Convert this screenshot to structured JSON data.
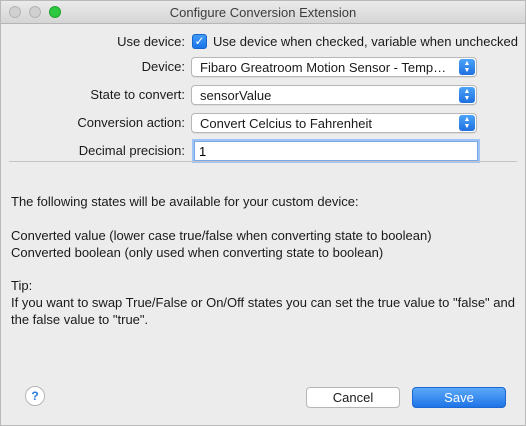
{
  "window": {
    "title": "Configure Conversion Extension"
  },
  "form": {
    "use_device": {
      "label": "Use device:",
      "checked": true,
      "checkbox_label": "Use device when checked, variable when unchecked"
    },
    "device": {
      "label": "Device:",
      "value": "Fibaro Greatroom Motion Sensor - Temperature"
    },
    "state_to_convert": {
      "label": "State to convert:",
      "value": "sensorValue"
    },
    "conversion_action": {
      "label": "Conversion action:",
      "value": "Convert Celcius to Fahrenheit"
    },
    "decimal_precision": {
      "label": "Decimal precision:",
      "value": "1"
    }
  },
  "info": {
    "intro": "The following states will be available for your custom device:",
    "states": [
      "Converted value (lower case true/false when converting state to boolean)",
      "Converted boolean (only used when converting state to boolean)"
    ],
    "tip_heading": "Tip:",
    "tip_body": "If you want to swap True/False or On/Off states you can set the true value to \"false\" and the false value to \"true\"."
  },
  "buttons": {
    "help": "?",
    "cancel": "Cancel",
    "save": "Save"
  },
  "colors": {
    "accent": "#1f74e6",
    "window_bg": "#ececec"
  }
}
